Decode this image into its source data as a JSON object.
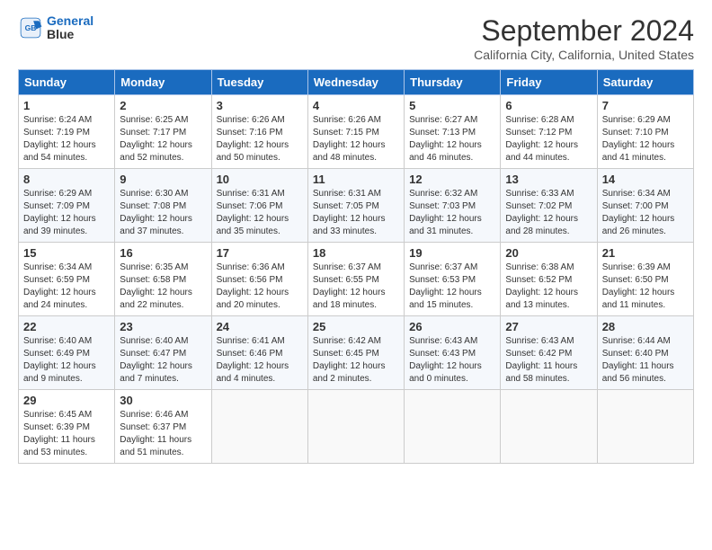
{
  "logo": {
    "line1": "General",
    "line2": "Blue"
  },
  "title": "September 2024",
  "subtitle": "California City, California, United States",
  "headers": [
    "Sunday",
    "Monday",
    "Tuesday",
    "Wednesday",
    "Thursday",
    "Friday",
    "Saturday"
  ],
  "weeks": [
    [
      {
        "day": "1",
        "sunrise": "6:24 AM",
        "sunset": "7:19 PM",
        "daylight": "12 hours and 54 minutes."
      },
      {
        "day": "2",
        "sunrise": "6:25 AM",
        "sunset": "7:17 PM",
        "daylight": "12 hours and 52 minutes."
      },
      {
        "day": "3",
        "sunrise": "6:26 AM",
        "sunset": "7:16 PM",
        "daylight": "12 hours and 50 minutes."
      },
      {
        "day": "4",
        "sunrise": "6:26 AM",
        "sunset": "7:15 PM",
        "daylight": "12 hours and 48 minutes."
      },
      {
        "day": "5",
        "sunrise": "6:27 AM",
        "sunset": "7:13 PM",
        "daylight": "12 hours and 46 minutes."
      },
      {
        "day": "6",
        "sunrise": "6:28 AM",
        "sunset": "7:12 PM",
        "daylight": "12 hours and 44 minutes."
      },
      {
        "day": "7",
        "sunrise": "6:29 AM",
        "sunset": "7:10 PM",
        "daylight": "12 hours and 41 minutes."
      }
    ],
    [
      {
        "day": "8",
        "sunrise": "6:29 AM",
        "sunset": "7:09 PM",
        "daylight": "12 hours and 39 minutes."
      },
      {
        "day": "9",
        "sunrise": "6:30 AM",
        "sunset": "7:08 PM",
        "daylight": "12 hours and 37 minutes."
      },
      {
        "day": "10",
        "sunrise": "6:31 AM",
        "sunset": "7:06 PM",
        "daylight": "12 hours and 35 minutes."
      },
      {
        "day": "11",
        "sunrise": "6:31 AM",
        "sunset": "7:05 PM",
        "daylight": "12 hours and 33 minutes."
      },
      {
        "day": "12",
        "sunrise": "6:32 AM",
        "sunset": "7:03 PM",
        "daylight": "12 hours and 31 minutes."
      },
      {
        "day": "13",
        "sunrise": "6:33 AM",
        "sunset": "7:02 PM",
        "daylight": "12 hours and 28 minutes."
      },
      {
        "day": "14",
        "sunrise": "6:34 AM",
        "sunset": "7:00 PM",
        "daylight": "12 hours and 26 minutes."
      }
    ],
    [
      {
        "day": "15",
        "sunrise": "6:34 AM",
        "sunset": "6:59 PM",
        "daylight": "12 hours and 24 minutes."
      },
      {
        "day": "16",
        "sunrise": "6:35 AM",
        "sunset": "6:58 PM",
        "daylight": "12 hours and 22 minutes."
      },
      {
        "day": "17",
        "sunrise": "6:36 AM",
        "sunset": "6:56 PM",
        "daylight": "12 hours and 20 minutes."
      },
      {
        "day": "18",
        "sunrise": "6:37 AM",
        "sunset": "6:55 PM",
        "daylight": "12 hours and 18 minutes."
      },
      {
        "day": "19",
        "sunrise": "6:37 AM",
        "sunset": "6:53 PM",
        "daylight": "12 hours and 15 minutes."
      },
      {
        "day": "20",
        "sunrise": "6:38 AM",
        "sunset": "6:52 PM",
        "daylight": "12 hours and 13 minutes."
      },
      {
        "day": "21",
        "sunrise": "6:39 AM",
        "sunset": "6:50 PM",
        "daylight": "12 hours and 11 minutes."
      }
    ],
    [
      {
        "day": "22",
        "sunrise": "6:40 AM",
        "sunset": "6:49 PM",
        "daylight": "12 hours and 9 minutes."
      },
      {
        "day": "23",
        "sunrise": "6:40 AM",
        "sunset": "6:47 PM",
        "daylight": "12 hours and 7 minutes."
      },
      {
        "day": "24",
        "sunrise": "6:41 AM",
        "sunset": "6:46 PM",
        "daylight": "12 hours and 4 minutes."
      },
      {
        "day": "25",
        "sunrise": "6:42 AM",
        "sunset": "6:45 PM",
        "daylight": "12 hours and 2 minutes."
      },
      {
        "day": "26",
        "sunrise": "6:43 AM",
        "sunset": "6:43 PM",
        "daylight": "12 hours and 0 minutes."
      },
      {
        "day": "27",
        "sunrise": "6:43 AM",
        "sunset": "6:42 PM",
        "daylight": "11 hours and 58 minutes."
      },
      {
        "day": "28",
        "sunrise": "6:44 AM",
        "sunset": "6:40 PM",
        "daylight": "11 hours and 56 minutes."
      }
    ],
    [
      {
        "day": "29",
        "sunrise": "6:45 AM",
        "sunset": "6:39 PM",
        "daylight": "11 hours and 53 minutes."
      },
      {
        "day": "30",
        "sunrise": "6:46 AM",
        "sunset": "6:37 PM",
        "daylight": "11 hours and 51 minutes."
      },
      null,
      null,
      null,
      null,
      null
    ]
  ]
}
